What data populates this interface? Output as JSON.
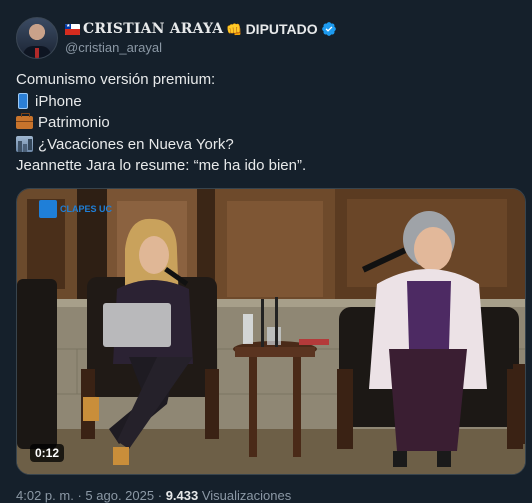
{
  "header": {
    "display_name": "CRISTIAN ARAYA",
    "fist_emoji": "👊",
    "title": "DIPUTADO",
    "handle": "@cristian_arayal",
    "verified_color": "#1d9bf0"
  },
  "tweet_text": {
    "line1": "Comunismo versión premium:",
    "item1": "iPhone",
    "item2": "Patrimonio",
    "item3": "¿Vacaciones en Nueva York?",
    "line5": "Jeannette Jara lo resume: “me ha ido bien”."
  },
  "media": {
    "duration": "0:12",
    "watermark": "CLAPES UC"
  },
  "meta": {
    "time": "4:02 p. m.",
    "separator": "·",
    "date": "5 ago. 2025",
    "views_count": "9.433",
    "views_label": "Visualizaciones"
  },
  "colors": {
    "background": "#15202b",
    "text": "#e7e9ea",
    "muted": "#8b98a5",
    "accent": "#1d9bf0"
  },
  "icons": [
    "chile-flag-icon",
    "fist-icon",
    "verified-icon",
    "more-icon",
    "phone-icon",
    "briefcase-icon",
    "city-icon"
  ]
}
